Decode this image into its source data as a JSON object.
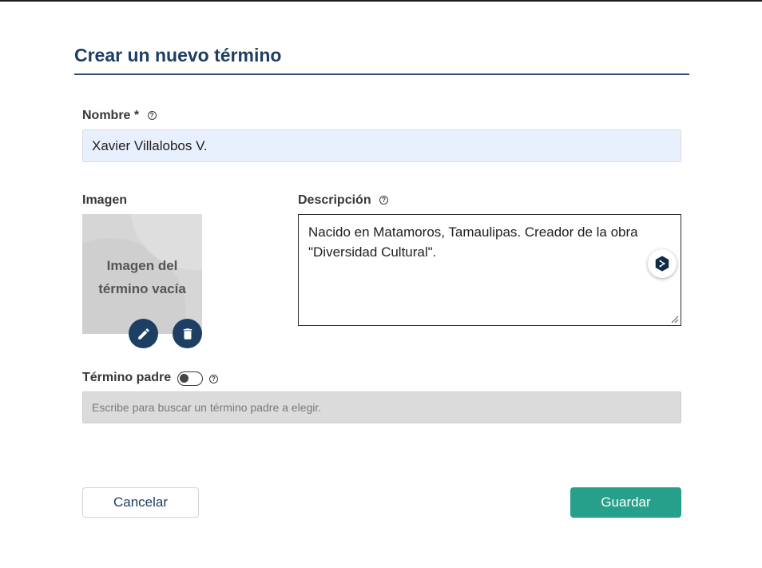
{
  "modal": {
    "title": "Crear un nuevo término"
  },
  "name_field": {
    "label": "Nombre *",
    "value": "Xavier Villalobos V."
  },
  "image_field": {
    "label": "Imagen",
    "empty_line1": "Imagen del",
    "empty_line2": "término vacía"
  },
  "description_field": {
    "label": "Descripción",
    "value": "Nacido en Matamoros, Tamaulipas. Creador de la obra \"Diversidad Cultural\"."
  },
  "parent_field": {
    "label": "Término padre",
    "toggle_on": false,
    "placeholder": "Escribe para buscar un término padre a elegir."
  },
  "footer": {
    "cancel_label": "Cancelar",
    "save_label": "Guardar"
  },
  "colors": {
    "primary": "#1d3f63",
    "save": "#26a08a",
    "name_input_bg": "#e8f0fe",
    "disabled_input_bg": "#dbdbdb"
  },
  "icons": {
    "help": "question-circle-icon",
    "edit": "pencil-icon",
    "delete": "trash-icon",
    "extension": "deepl-extension-icon"
  }
}
